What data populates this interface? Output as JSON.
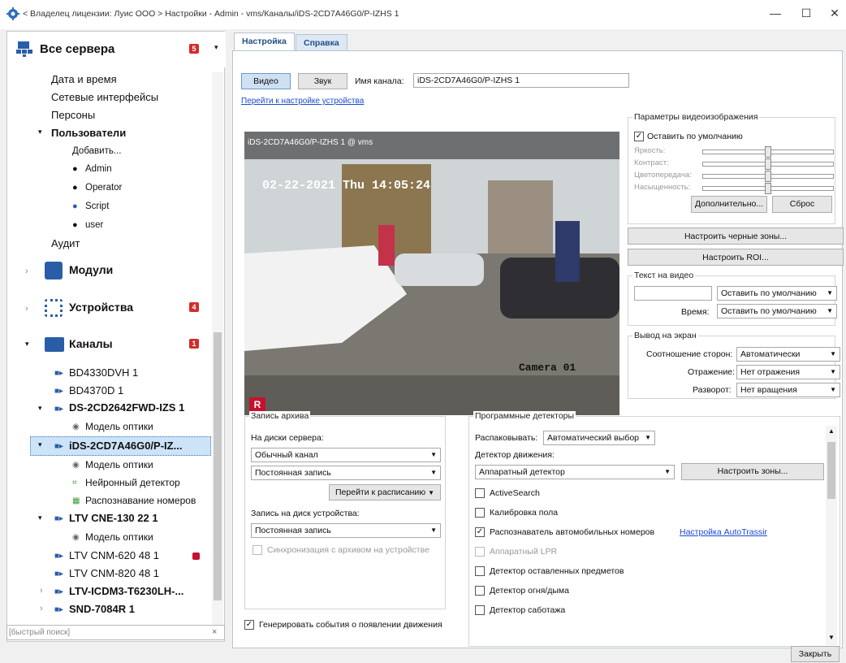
{
  "window": {
    "title": "< Владелец лицензии: Луис ООО > Настройки - Admin - vms/Каналы/iDS-2CD7A46G0/P-IZHS 1",
    "minimize": "—",
    "maximize": "☐",
    "close": "✕"
  },
  "sidebar": {
    "header": "Все сервера",
    "header_badge": "5",
    "settings_items": [
      "Дата и время",
      "Сетевые интерфейсы",
      "Персоны"
    ],
    "users_label": "Пользователи",
    "users": [
      "Добавить...",
      "Admin",
      "Operator",
      "Script",
      "user"
    ],
    "audit": "Аудит",
    "modules": "Модули",
    "devices": "Устройства",
    "devices_badge": "4",
    "channels": "Каналы",
    "channels_badge": "1",
    "ch1": "BD4330DVH 1",
    "ch2": "BD4370D 1",
    "ch3": "DS-2CD2642FWD-IZS 1",
    "ch3_sub": "Модель оптики",
    "ch4": "iDS-2CD7A46G0/P-IZ...",
    "ch4_subs": [
      "Модель оптики",
      "Нейронный детектор",
      "Распознавание номеров"
    ],
    "ch5": "LTV CNE-130 22 1",
    "ch5_sub": "Модель оптики",
    "ch6": "LTV CNM-620 48 1",
    "ch7": "LTV CNM-820 48 1",
    "ch8": "LTV-ICDM3-T6230LH-...",
    "ch9": "SND-7084R 1",
    "search_placeholder": "[быстрый поиск]",
    "search_clear": "×"
  },
  "tabs": [
    "Настройка",
    "Справка"
  ],
  "top": {
    "video_btn": "Видео",
    "sound_btn": "Звук",
    "channel_name_label": "Имя канала:",
    "channel_name_value": "iDS-2CD7A46G0/P-IZHS 1",
    "device_link": "Перейти к настройке устройства"
  },
  "video": {
    "overlay_title": "iDS-2CD7A46G0/P-IZHS 1 @ vms",
    "osd_time": "02-22-2021 Thu 14:05:24",
    "osd_camera": "Camera 01",
    "rec_badge": "R"
  },
  "image_params": {
    "title": "Параметры видеоизображения",
    "default_cb": "Оставить по умолчанию",
    "brightness": "Яркость:",
    "contrast": "Контраст:",
    "color": "Цветопередача:",
    "saturation": "Насыщенность:",
    "slider_levels": [
      0.5,
      0.5,
      0.5,
      0.5
    ],
    "more_btn": "Дополнительно...",
    "reset_btn": "Сброс"
  },
  "black_zones_btn": "Настроить черные зоны...",
  "roi_btn": "Настроить ROI...",
  "text_on_video": {
    "title": "Текст на видео",
    "text_combo": "Оставить по умолчанию",
    "time_label": "Время:",
    "time_combo": "Оставить по умолчанию"
  },
  "display": {
    "title": "Вывод на экран",
    "aspect_label": "Соотношение сторон:",
    "aspect_value": "Автоматически",
    "mirror_label": "Отражение:",
    "mirror_value": "Нет отражения",
    "rotate_label": "Разворот:",
    "rotate_value": "Нет вращения"
  },
  "archive": {
    "title": "Запись архива",
    "server_disks_label": "На диски сервера:",
    "stream_combo": "Обычный канал",
    "mode_combo": "Постоянная запись",
    "schedule_btn": "Перейти к расписанию",
    "device_disk_label": "Запись на диск устройства:",
    "device_mode_combo": "Постоянная запись",
    "sync_cb": "Синхронизация с архивом на устройстве",
    "motion_events_cb": "Генерировать события о появлении движения"
  },
  "detectors": {
    "title": "Программные детекторы",
    "decode_label": "Распаковывать:",
    "decode_value": "Автоматический выбор",
    "motion_label": "Детектор движения:",
    "motion_value": "Аппаратный детектор",
    "zones_btn": "Настроить зоны...",
    "items": [
      {
        "label": "ActiveSearch",
        "checked": false,
        "disabled": false
      },
      {
        "label": "Калибровка пола",
        "checked": false,
        "disabled": false
      },
      {
        "label": "Распознаватель автомобильных номеров",
        "checked": true,
        "disabled": false
      },
      {
        "label": "Аппаратный LPR",
        "checked": false,
        "disabled": true
      },
      {
        "label": "Детектор оставленных предметов",
        "checked": false,
        "disabled": false
      },
      {
        "label": "Детектор огня/дыма",
        "checked": false,
        "disabled": false
      },
      {
        "label": "Детектор саботажа",
        "checked": false,
        "disabled": false
      }
    ],
    "autotrassir_link": "Настройка AutoTrassir"
  },
  "close_btn": "Закрыть"
}
